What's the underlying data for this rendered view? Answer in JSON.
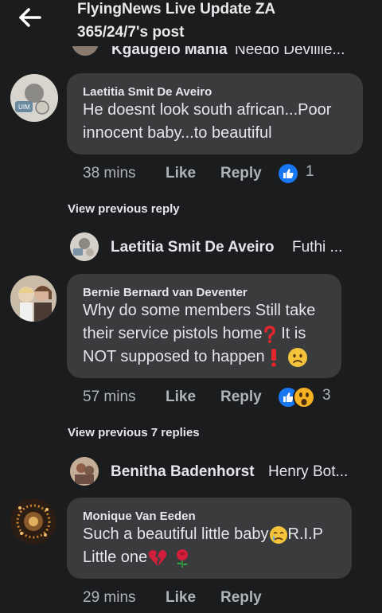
{
  "header": {
    "title_line1": "FlyingNews Live Update ZA",
    "title_line2": "365/24/7's post"
  },
  "cropped_reply": {
    "name": "Kgaugelo Mahla",
    "preview": "Needo Devillie..."
  },
  "comments": [
    {
      "author": "Laetitia Smit De Aveiro",
      "line1": "He doesnt look south african...Poor",
      "line2": "innocent baby...to beautiful",
      "time": "38 mins",
      "like": "Like",
      "reply": "Reply",
      "reaction_count": "1"
    },
    {
      "author": "Bernie Bernard van Deventer",
      "line1": "Why do some members Still take",
      "line2a": "their service pistols home",
      "line2b": " It is",
      "line3": "NOT supposed to happen",
      "time": "57 mins",
      "like": "Like",
      "reply": "Reply",
      "reaction_count": "3"
    },
    {
      "author": "Monique Van Eeden",
      "line1a": "Such a beautiful little baby",
      "line1b": "R.I.P",
      "line2": "Little one",
      "time": "29 mins",
      "like": "Like",
      "reply": "Reply"
    }
  ],
  "view_previous": [
    "View previous reply",
    "View previous 7 replies"
  ],
  "reply_previews": [
    {
      "name": "Laetitia Smit De Aveiro",
      "text": "Futhi ..."
    },
    {
      "name": "Benitha Badenhorst",
      "text": "Henry Bot..."
    }
  ],
  "colors": {
    "background": "#1b1c1e",
    "bubble": "#3a3b3c",
    "like_blue": "#1877f2",
    "secondary_text": "#b0b3b8"
  },
  "icons": [
    "back-arrow-icon",
    "like-reaction-icon",
    "wow-reaction-icon",
    "question-mark-icon",
    "exclamation-icon",
    "confused-face-icon",
    "crying-face-icon",
    "broken-heart-icon",
    "rose-icon"
  ]
}
